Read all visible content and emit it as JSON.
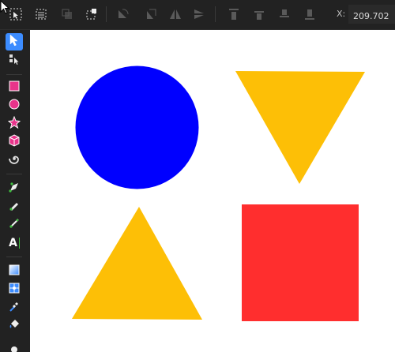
{
  "top_toolbar": {
    "x_label": "X:",
    "x_value": "209.702"
  },
  "tools": [
    {
      "name": "selector-tool",
      "icon": "arrow-pointer-icon",
      "active": true
    },
    {
      "name": "node-tool",
      "icon": "node-edit-icon",
      "active": false
    },
    {
      "name": "rectangle-tool",
      "icon": "square-icon",
      "active": false
    },
    {
      "name": "ellipse-tool",
      "icon": "circle-icon",
      "active": false
    },
    {
      "name": "star-tool",
      "icon": "star-icon",
      "active": false
    },
    {
      "name": "3d-box-tool",
      "icon": "cube-icon",
      "active": false
    },
    {
      "name": "spiral-tool",
      "icon": "spiral-icon",
      "active": false
    },
    {
      "name": "pen-tool",
      "icon": "pen-icon",
      "active": false
    },
    {
      "name": "pencil-tool",
      "icon": "pencil-icon",
      "active": false
    },
    {
      "name": "calligraphy-tool",
      "icon": "calligraphy-icon",
      "active": false
    },
    {
      "name": "text-tool",
      "icon": "text-icon",
      "active": false
    },
    {
      "name": "gradient-tool",
      "icon": "gradient-icon",
      "active": false
    },
    {
      "name": "mesh-tool",
      "icon": "mesh-icon",
      "active": false
    },
    {
      "name": "dropper-tool",
      "icon": "dropper-icon",
      "active": false
    },
    {
      "name": "paint-bucket-tool",
      "icon": "paint-bucket-icon",
      "active": false
    }
  ],
  "text_tool_glyph": "A",
  "shapes": [
    {
      "name": "blue-circle",
      "color": "#0000ff"
    },
    {
      "name": "yellow-inverted-triangle",
      "color": "#fdbf06"
    },
    {
      "name": "yellow-triangle",
      "color": "#fdbf06"
    },
    {
      "name": "red-square",
      "color": "#ff2e2e"
    }
  ],
  "colors": {
    "accent": "#3c8cff",
    "rect_tool_pink": "#e8338a",
    "tool_green": "#3fbf3f"
  }
}
